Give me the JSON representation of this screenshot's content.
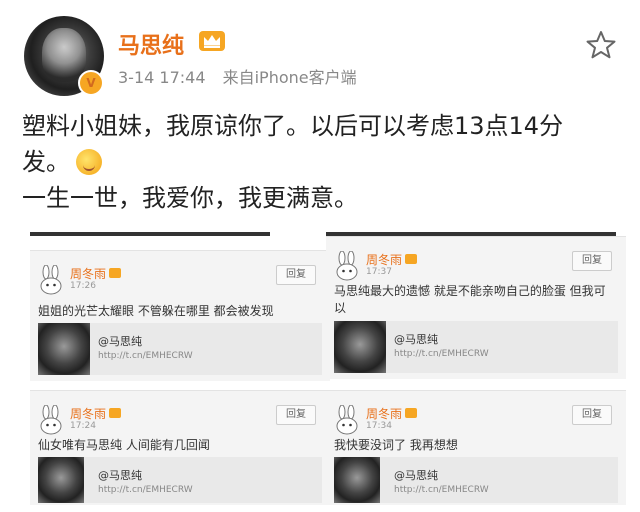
{
  "header": {
    "username": "马思纯",
    "timestamp": "3-14 17:44",
    "source": "来自iPhone客户端",
    "verified_mark": "V",
    "brand_color": "#e8701a"
  },
  "post": {
    "line1": "塑料小姐妹，我原谅你了。以后可以考虑13点14分",
    "line2": "发。",
    "line3": "一生一世，我爱你，我更满意。"
  },
  "cards": [
    {
      "author": "周冬雨",
      "time": "17:26",
      "text": "姐姐的光芒太耀眼 不管躲在哪里 都会被发现",
      "reply_label": "回复",
      "link_name": "@马思纯",
      "link_url": "http://t.cn/EMHECRW"
    },
    {
      "author": "周冬雨",
      "time": "17:37",
      "text": "马思纯最大的遗憾 就是不能亲吻自己的脸蛋 但我可以",
      "reply_label": "回复",
      "link_name": "@马思纯",
      "link_url": "http://t.cn/EMHECRW"
    },
    {
      "author": "周冬雨",
      "time": "17:24",
      "text": "仙女唯有马思纯 人间能有几回闻",
      "reply_label": "回复",
      "link_name": "@马思纯",
      "link_url": "http://t.cn/EMHECRW"
    },
    {
      "author": "周冬雨",
      "time": "17:34",
      "text": "我快要没词了 我再想想",
      "reply_label": "回复",
      "link_name": "@马思纯",
      "link_url": "http://t.cn/EMHECRW"
    }
  ],
  "icons": {
    "crown": "crown-icon",
    "star": "star-icon",
    "emoji": "yum-face-emoji-icon"
  }
}
